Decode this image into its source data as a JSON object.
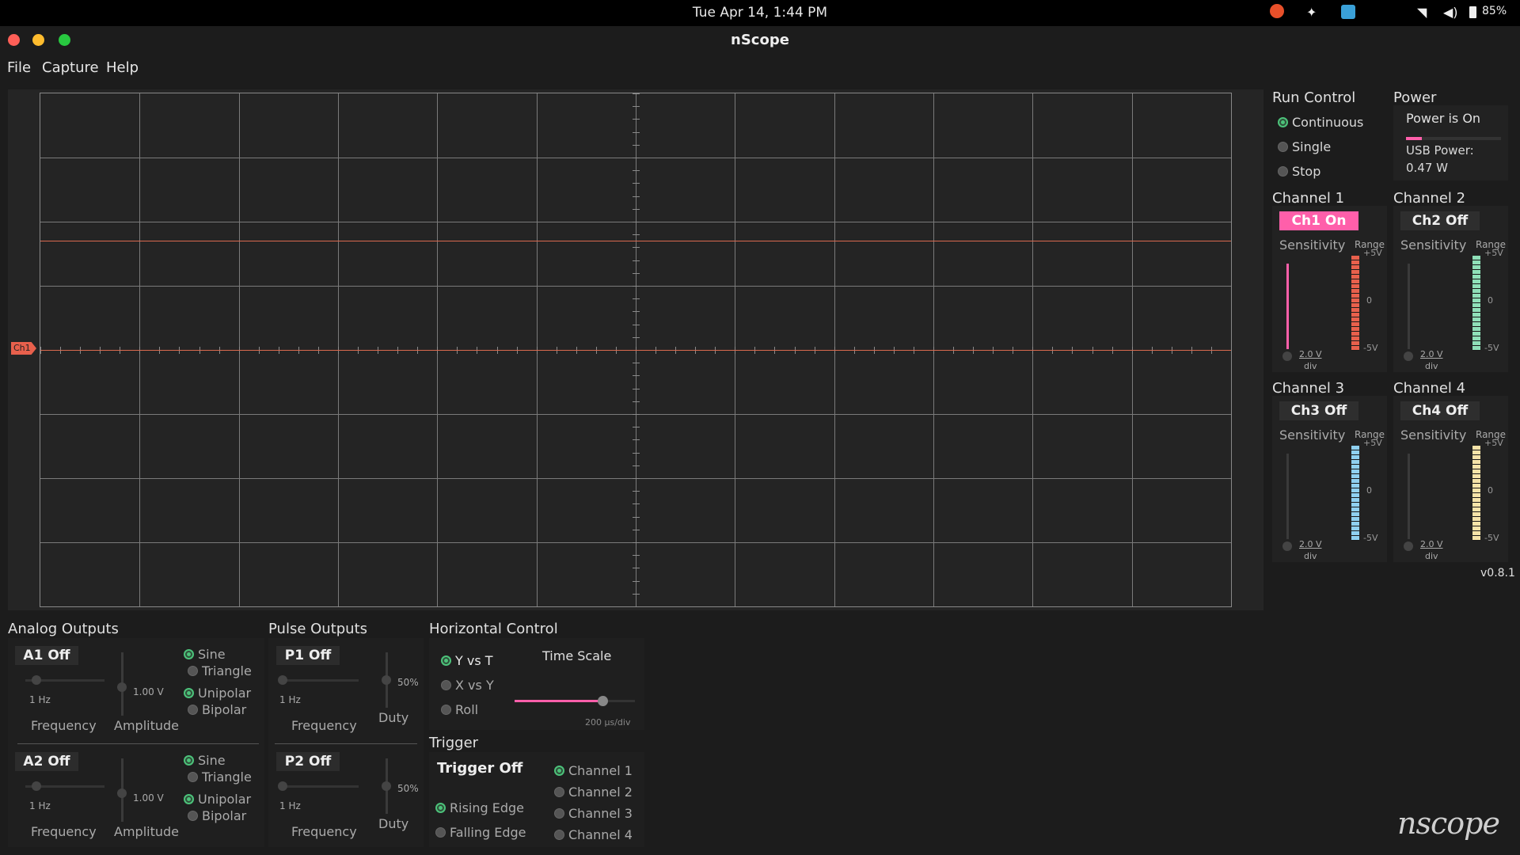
{
  "system": {
    "clock": "Tue Apr 14,  1:44 PM",
    "battery": "85%",
    "tray_icons": [
      "update-icon",
      "dropbox-icon",
      "app-icon",
      "wifi-icon",
      "volume-icon",
      "battery-icon"
    ]
  },
  "window": {
    "title": "nScope",
    "menu": [
      "File",
      "Capture",
      "Help"
    ]
  },
  "scope": {
    "marker": "Ch1",
    "trace_color": "#d9694f"
  },
  "run_control": {
    "title": "Run Control",
    "options": [
      "Continuous",
      "Single",
      "Stop"
    ],
    "selected": "Continuous"
  },
  "power": {
    "title": "Power",
    "status": "Power is On",
    "usb_label": "USB Power:",
    "usb_value": "0.47 W"
  },
  "channels": [
    {
      "title": "Channel 1",
      "button": "Ch1 On",
      "sensitivity": "Sensitivity",
      "range": "Range",
      "value": "2.0 V",
      "unit": "div",
      "top": "+5V",
      "mid": "0",
      "bottom": "-5V",
      "color": "#e8604c"
    },
    {
      "title": "Channel 2",
      "button": "Ch2 Off",
      "sensitivity": "Sensitivity",
      "range": "Range",
      "value": "2.0 V",
      "unit": "div",
      "top": "+5V",
      "mid": "0",
      "bottom": "-5V",
      "color": "#8fe0b8"
    },
    {
      "title": "Channel 3",
      "button": "Ch3 Off",
      "sensitivity": "Sensitivity",
      "range": "Range",
      "value": "2.0 V",
      "unit": "div",
      "top": "+5V",
      "mid": "0",
      "bottom": "-5V",
      "color": "#8fd0f0"
    },
    {
      "title": "Channel 4",
      "button": "Ch4 Off",
      "sensitivity": "Sensitivity",
      "range": "Range",
      "value": "2.0 V",
      "unit": "div",
      "top": "+5V",
      "mid": "0",
      "bottom": "-5V",
      "color": "#f5e3a8"
    }
  ],
  "version": "v0.8.1",
  "analog_outputs": {
    "title": "Analog Outputs",
    "items": [
      {
        "button": "A1 Off",
        "freq_value": "1 Hz",
        "amp_value": "1.00 V",
        "freq_label": "Frequency",
        "amp_label": "Amplitude",
        "wave": [
          "Sine",
          "Triangle"
        ],
        "polarity": [
          "Unipolar",
          "Bipolar"
        ]
      },
      {
        "button": "A2 Off",
        "freq_value": "1 Hz",
        "amp_value": "1.00 V",
        "freq_label": "Frequency",
        "amp_label": "Amplitude",
        "wave": [
          "Sine",
          "Triangle"
        ],
        "polarity": [
          "Unipolar",
          "Bipolar"
        ]
      }
    ]
  },
  "pulse_outputs": {
    "title": "Pulse Outputs",
    "items": [
      {
        "button": "P1 Off",
        "freq_value": "1 Hz",
        "duty_value": "50%",
        "freq_label": "Frequency",
        "duty_label": "Duty"
      },
      {
        "button": "P2 Off",
        "freq_value": "1 Hz",
        "duty_value": "50%",
        "freq_label": "Frequency",
        "duty_label": "Duty"
      }
    ]
  },
  "horizontal": {
    "title": "Horizontal Control",
    "modes": [
      "Y vs T",
      "X vs Y",
      "Roll"
    ],
    "time_scale_label": "Time Scale",
    "time_scale_value": "200 μs/div",
    "time_scale_level": 0.73
  },
  "trigger": {
    "title": "Trigger",
    "button": "Trigger Off",
    "edges": [
      "Rising Edge",
      "Falling Edge"
    ],
    "channels": [
      "Channel 1",
      "Channel 2",
      "Channel 3",
      "Channel 4"
    ]
  },
  "logo": "nscope"
}
